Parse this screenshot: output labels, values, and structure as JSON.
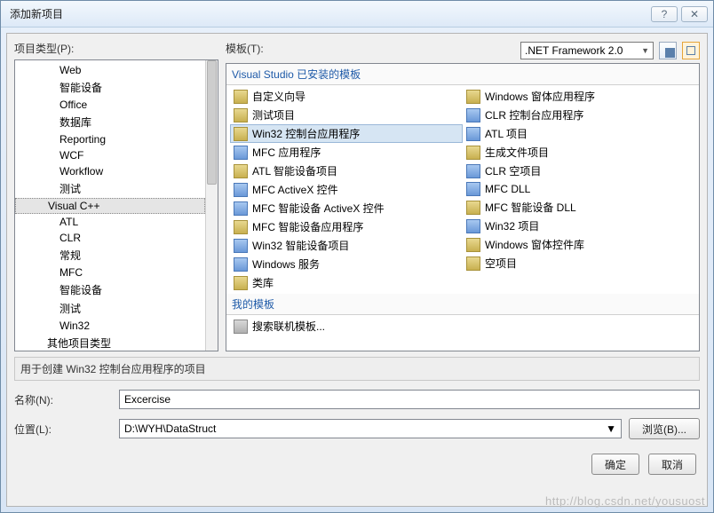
{
  "window": {
    "title": "添加新项目"
  },
  "labels": {
    "project_types": "项目类型(P):",
    "templates": "模板(T):",
    "description": "用于创建 Win32 控制台应用程序的项目",
    "name": "名称(N):",
    "location": "位置(L):",
    "browse": "浏览(B)...",
    "ok": "确定",
    "cancel": "取消",
    "installed_templates": "Visual Studio 已安装的模板",
    "my_templates": "我的模板"
  },
  "framework": {
    "selected": ".NET Framework 2.0"
  },
  "tree": {
    "items": [
      {
        "label": "Web",
        "level": 2
      },
      {
        "label": "智能设备",
        "level": 2
      },
      {
        "label": "Office",
        "level": 2
      },
      {
        "label": "数据库",
        "level": 2
      },
      {
        "label": "Reporting",
        "level": 2
      },
      {
        "label": "WCF",
        "level": 2
      },
      {
        "label": "Workflow",
        "level": 2
      },
      {
        "label": "测试",
        "level": 2
      },
      {
        "label": "Visual C++",
        "level": 1,
        "selected": true
      },
      {
        "label": "ATL",
        "level": 2
      },
      {
        "label": "CLR",
        "level": 2
      },
      {
        "label": "常规",
        "level": 2
      },
      {
        "label": "MFC",
        "level": 2
      },
      {
        "label": "智能设备",
        "level": 2
      },
      {
        "label": "测试",
        "level": 2
      },
      {
        "label": "Win32",
        "level": 2
      },
      {
        "label": "其他项目类型",
        "level": 1
      }
    ]
  },
  "templates_left": [
    "自定义向导",
    "测试项目",
    "Win32 控制台应用程序",
    "MFC 应用程序",
    "ATL 智能设备项目",
    "MFC ActiveX 控件",
    "MFC 智能设备 ActiveX 控件",
    "MFC 智能设备应用程序",
    "Win32 智能设备项目",
    "Windows 服务",
    "类库"
  ],
  "templates_right": [
    "Windows 窗体应用程序",
    "CLR 控制台应用程序",
    "ATL 项目",
    "生成文件项目",
    "CLR 空项目",
    "MFC DLL",
    "MFC 智能设备 DLL",
    "Win32 项目",
    "Windows 窗体控件库",
    "空项目"
  ],
  "selected_template_index": 2,
  "my_templates_item": "搜索联机模板...",
  "form": {
    "name_value": "Excercise",
    "location_value": "D:\\WYH\\DataStruct"
  },
  "watermark": "http://blog.csdn.net/yousuost"
}
